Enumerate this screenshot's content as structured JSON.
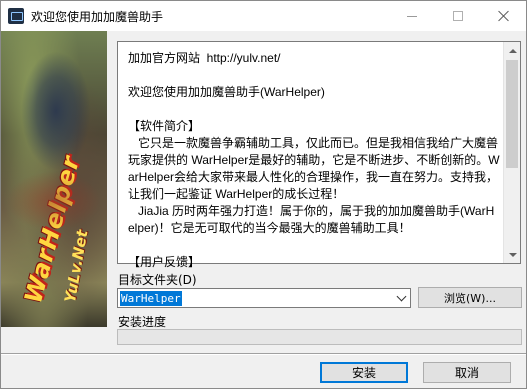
{
  "window": {
    "title": "欢迎您使用加加魔兽助手",
    "icon": "app-icon"
  },
  "banner": {
    "logo_text": "WarHelper",
    "logo_subtext": "YuLv.Net"
  },
  "info": {
    "paragraphs": [
      "加加官方网站  http://yulv.net/",
      "",
      "欢迎您使用加加魔兽助手(WarHelper)",
      "",
      "【软件简介】",
      "   它只是一款魔兽争霸辅助工具，仅此而已。但是我相信我给广大魔兽玩家提供的 WarHelper是最好的辅助，它是不断进步、不断创新的。WarHelper会给大家带来最人性化的合理操作，我一直在努力。支持我，让我们一起鉴证 WarHelper的成长过程！",
      "   JiaJia 历时两年强力打造！属于你的，属于我的加加魔兽助手(WarHelper)！它是无可取代的当今最强大的魔兽辅助工具！",
      "",
      "【用户反馈】"
    ]
  },
  "target_folder": {
    "label": "目标文件夹(D)",
    "value": "WarHelper"
  },
  "browse_button": "浏览(W)...",
  "progress": {
    "label": "安装进度",
    "value": 0
  },
  "buttons": {
    "install": "安装",
    "cancel": "取消"
  },
  "colors": {
    "selection": "#0078d7",
    "logo": "#ffd640"
  }
}
